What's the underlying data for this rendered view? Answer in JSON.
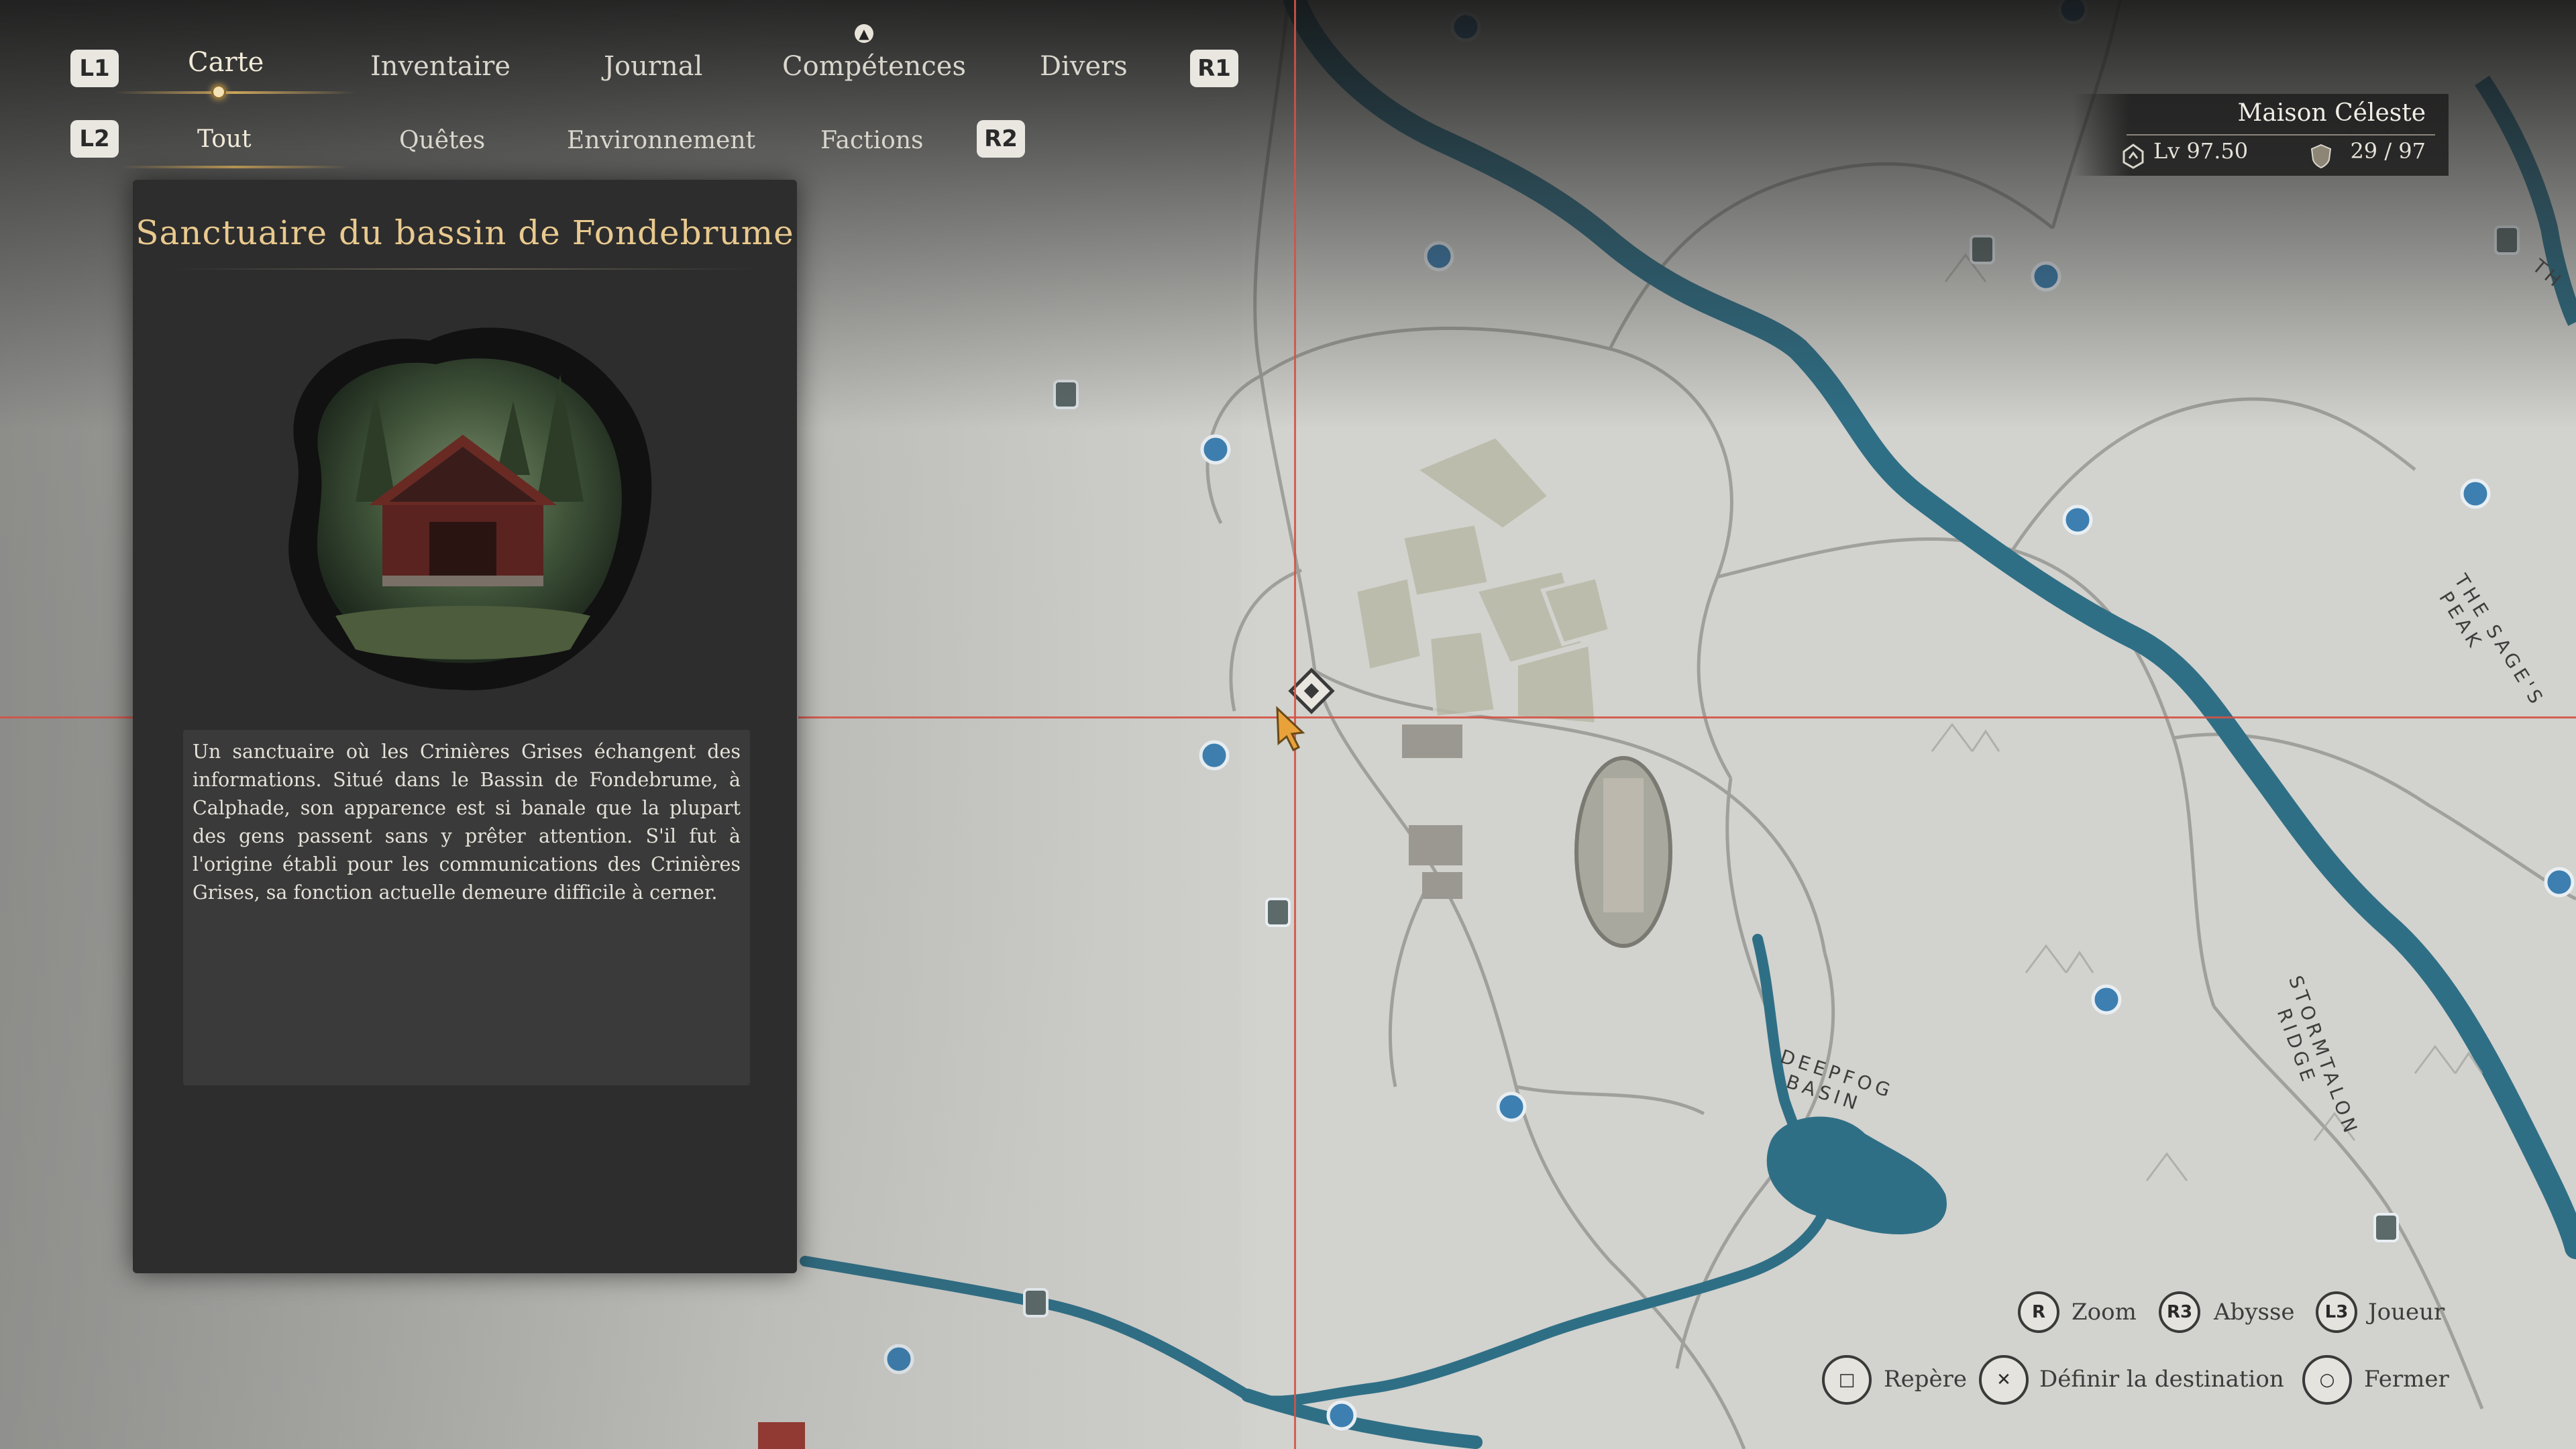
{
  "nav": {
    "l1": "L1",
    "r1": "R1",
    "l2": "L2",
    "r2": "R2",
    "tabs": [
      "Carte",
      "Inventaire",
      "Journal",
      "Compétences",
      "Divers"
    ],
    "filters": [
      "Tout",
      "Quêtes",
      "Environnement",
      "Factions"
    ],
    "active_tab": "Carte",
    "active_filter": "Tout"
  },
  "panel": {
    "title": "Sanctuaire du bassin de Fondebrume",
    "description": "Un sanctuaire où les Crinières Grises échangent des informations. Situé dans le Bassin de Fondebrume, à Calphade, son apparence est si banale que la plupart des gens passent sans y prêter attention. S'il fut à l'origine établi pour les communications des Crinières Grises, sa fonction actuelle demeure difficile à cerner."
  },
  "status": {
    "name": "Maison Céleste",
    "level_label": "Lv",
    "level_value": "97.50",
    "count_current": "29",
    "count_sep": "/",
    "count_total": "97"
  },
  "map_labels": {
    "deepfog": "DEEPFOG BASIN",
    "deepfog_line1": "DEEPFOG",
    "deepfog_line2": "BASIN",
    "stormtalon_line1": "STORMTALON",
    "stormtalon_line2": "RIDGE",
    "sages_line1": "THE SAGE'S",
    "sages_line2": "PEAK",
    "edge_th": "TH"
  },
  "controls": {
    "zoom_btn": "R",
    "zoom": "Zoom",
    "abyss_btn": "R3",
    "abyss": "Abysse",
    "player_btn": "L3",
    "player": "Joueur",
    "marker_btn": "□",
    "marker": "Repère",
    "destination_btn": "✕",
    "destination": "Définir la destination",
    "close_btn": "○",
    "close": "Fermer"
  },
  "colors": {
    "map_bg": "#cfcfcb",
    "river": "#2f6f86",
    "road": "#8f8f8b",
    "crosshair": "#d45245",
    "accent_gold": "#c9a35b",
    "title_gold": "#e9c98e",
    "waypoint": "#3d7fb0"
  }
}
